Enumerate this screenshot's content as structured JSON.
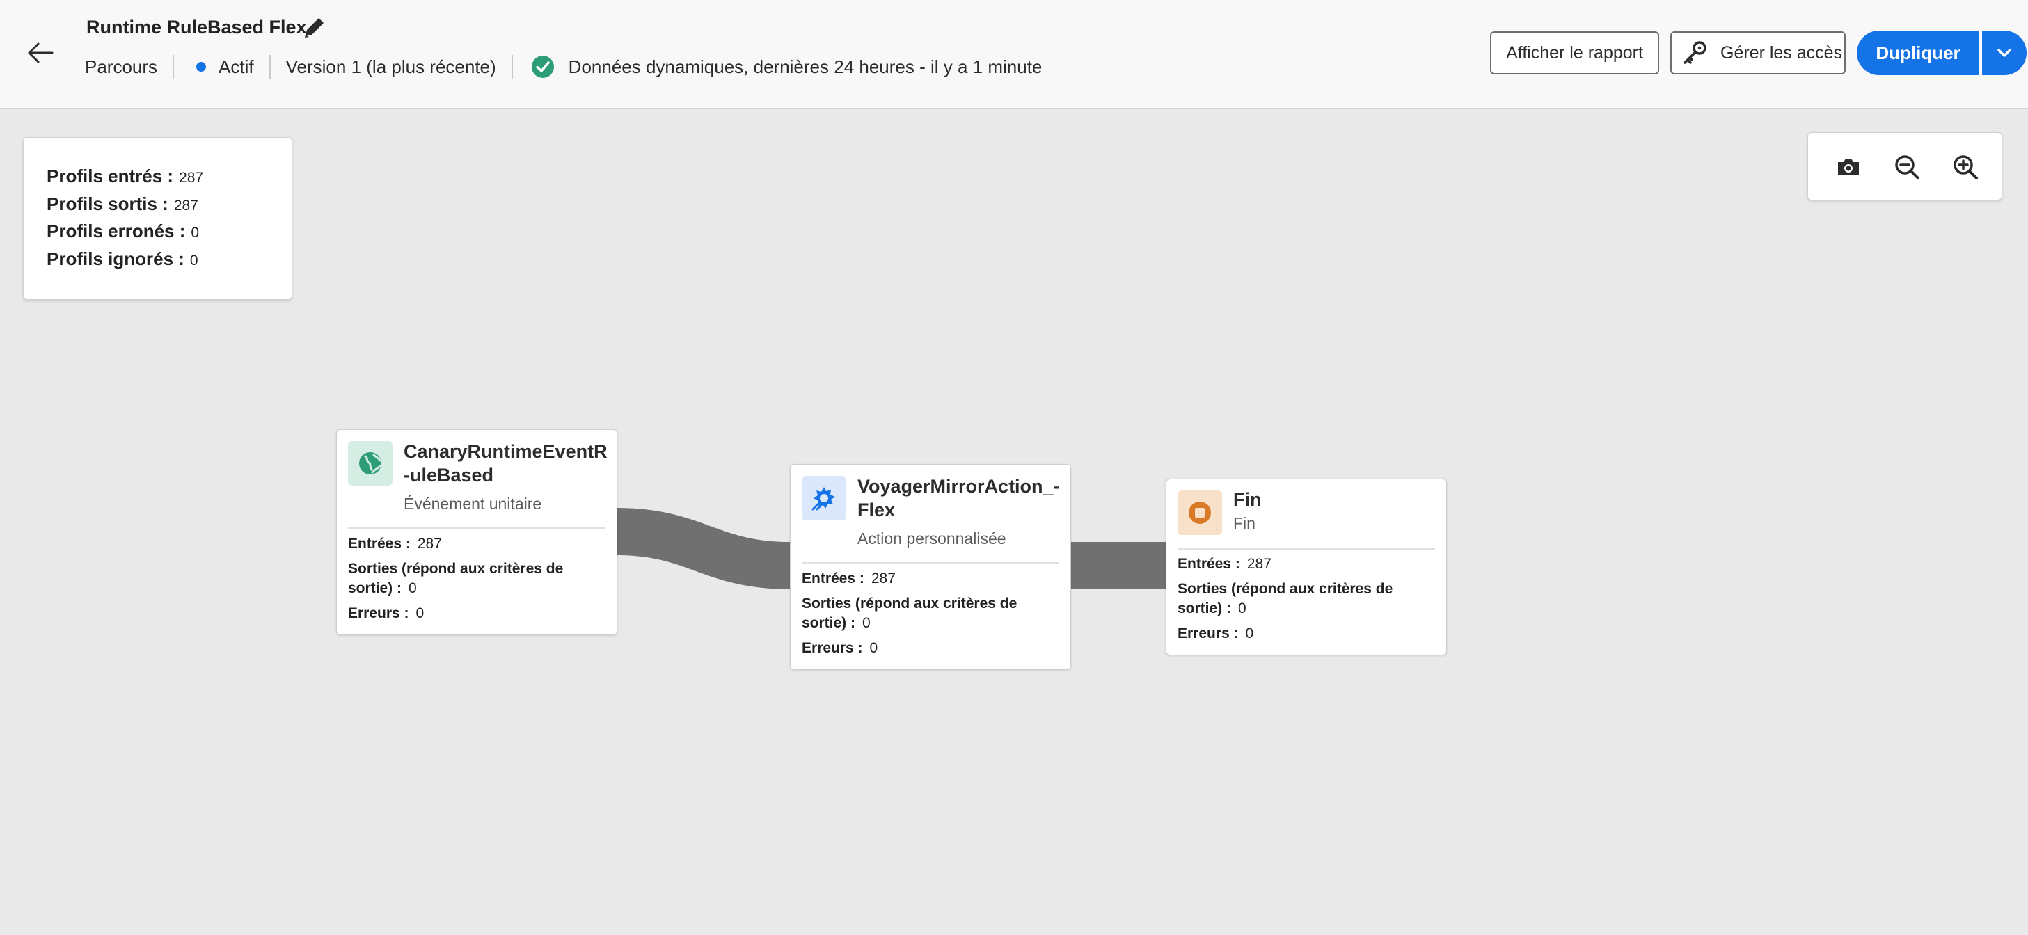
{
  "header": {
    "title": "Runtime RuleBased Flex",
    "breadcrumb": "Parcours",
    "status": "Actif",
    "version": "Version 1 (la plus récente)",
    "data_status": "Données dynamiques, dernières 24 heures - il y a 1 minute",
    "buttons": {
      "report": "Afficher le rapport",
      "access": "Gérer les accès",
      "duplicate": "Dupliquer"
    }
  },
  "stats": [
    {
      "label": "Profils entrés :",
      "value": "287"
    },
    {
      "label": "Profils sortis :",
      "value": "287"
    },
    {
      "label": "Profils erronés :",
      "value": "0"
    },
    {
      "label": "Profils ignorés :",
      "value": "0"
    }
  ],
  "toolbar": {
    "icons": [
      "camera-icon",
      "zoom-out-icon",
      "zoom-in-icon"
    ]
  },
  "nodes": [
    {
      "name": "CanaryRuntimeEventR-uleBased",
      "type": "Événement unitaire",
      "icon": "globe-icon",
      "entries_label": "Entrées :",
      "entries": "287",
      "exits_label": "Sorties (répond aux critères de sortie) :",
      "exits": "0",
      "errors_label": "Erreurs :",
      "errors": "0"
    },
    {
      "name": "VoyagerMirrorAction_-Flex",
      "type": "Action personnalisée",
      "icon": "custom-action-icon",
      "entries_label": "Entrées :",
      "entries": "287",
      "exits_label": "Sorties (répond aux critères de sortie) :",
      "exits": "0",
      "errors_label": "Erreurs :",
      "errors": "0"
    },
    {
      "name": "Fin",
      "type": "Fin",
      "icon": "stop-icon",
      "entries_label": "Entrées :",
      "entries": "287",
      "exits_label": "Sorties (répond aux critères de sortie) :",
      "exits": "0",
      "errors_label": "Erreurs :",
      "errors": "0"
    }
  ],
  "colors": {
    "accent": "#1473e6",
    "success": "#2d9d78",
    "event_icon_bg": "#d6ede3",
    "event_icon": "#2d9d78",
    "action_icon_bg": "#dbe7fb",
    "action_icon": "#1473e6",
    "end_icon_bg": "#f8e0c9",
    "end_icon": "#d97a26",
    "link": "#707070"
  }
}
